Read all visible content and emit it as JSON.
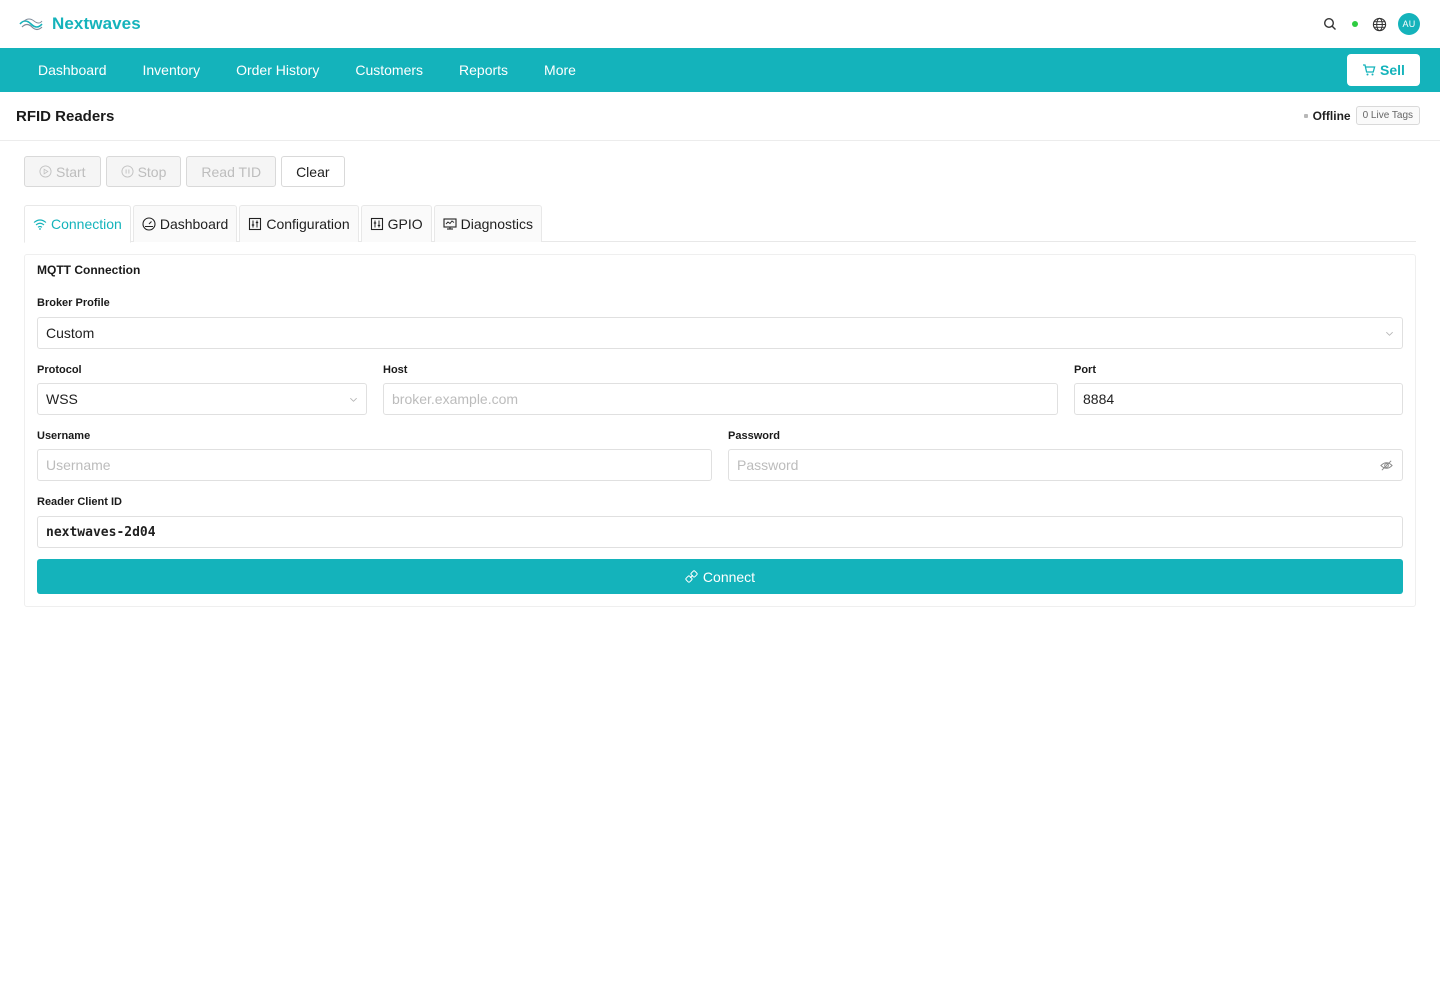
{
  "brand": {
    "name": "Nextwaves"
  },
  "topbar": {
    "avatar_initials": "AU",
    "status_color": "#2ecc40"
  },
  "nav": {
    "items": [
      "Dashboard",
      "Inventory",
      "Order History",
      "Customers",
      "Reports",
      "More"
    ],
    "sell_label": "Sell"
  },
  "page": {
    "title": "RFID Readers",
    "status": "Offline",
    "live_tags": "0 Live Tags"
  },
  "actions": {
    "start": "Start",
    "stop": "Stop",
    "read_tid": "Read TID",
    "clear": "Clear"
  },
  "tabs": [
    "Connection",
    "Dashboard",
    "Configuration",
    "GPIO",
    "Diagnostics"
  ],
  "mqtt": {
    "title": "MQTT Connection",
    "broker_profile_label": "Broker Profile",
    "broker_profile_value": "Custom",
    "protocol_label": "Protocol",
    "protocol_value": "WSS",
    "host_label": "Host",
    "host_placeholder": "broker.example.com",
    "port_label": "Port",
    "port_value": "8884",
    "username_label": "Username",
    "username_placeholder": "Username",
    "password_label": "Password",
    "password_placeholder": "Password",
    "client_id_label": "Reader Client ID",
    "client_id_value": "nextwaves-2d04",
    "connect_label": "Connect"
  },
  "colors": {
    "accent": "#14b3bb"
  }
}
